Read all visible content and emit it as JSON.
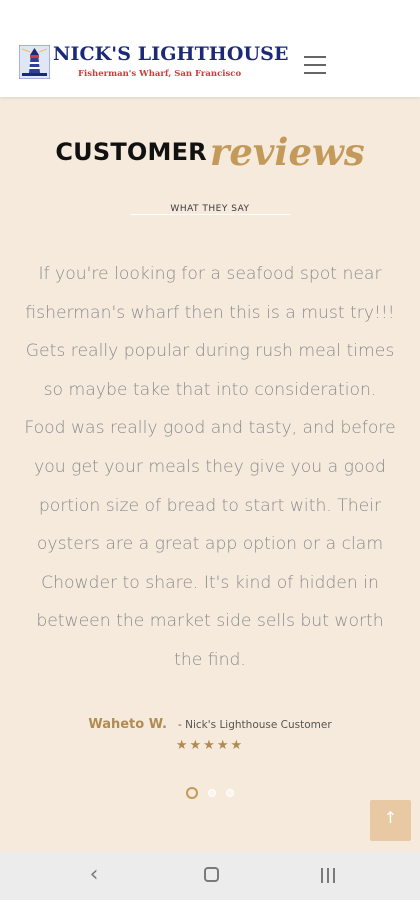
{
  "header": {
    "brand_name": "NICK'S LIGHTHOUSE",
    "brand_tagline": "Fisherman's Wharf, San Francisco",
    "logo_icon": "lighthouse-icon",
    "menu_icon": "hamburger-menu-icon"
  },
  "section": {
    "title_bold": "CUSTOMER",
    "title_script": "reviews",
    "subtitle": "WHAT THEY SAY"
  },
  "review": {
    "lines": [
      "If you're looking for a seafood spot near",
      "fisherman's wharf then this is a must try!!!",
      "Gets really popular during rush meal times",
      "so maybe take that into consideration.",
      "Food was really good and tasty, and before",
      "you get your meals they give you a good",
      "portion size of bread to start with. Their",
      "oysters are a great app option or a clam",
      "Chowder to share. It's kind of hidden in",
      "between the market side sells but worth",
      "the find."
    ],
    "author": "Waheto W.",
    "author_role": "- Nick's Lighthouse Customer",
    "rating": 5,
    "stars": "★★★★★"
  },
  "carousel": {
    "slide_count": 3,
    "active_slide": 1
  },
  "back_to_top_icon": "arrow-up-icon",
  "system_nav": {
    "back_icon": "back-chevron-icon",
    "home_icon": "home-square-icon",
    "recents_icon": "recents-icon",
    "back_glyph": "‹"
  },
  "colors": {
    "page_background": "#f6eadc",
    "brand_navy": "#1b2a78",
    "brand_red": "#d23b3b",
    "accent_gold": "#c39a5a",
    "review_text": "#8c8c8c"
  }
}
